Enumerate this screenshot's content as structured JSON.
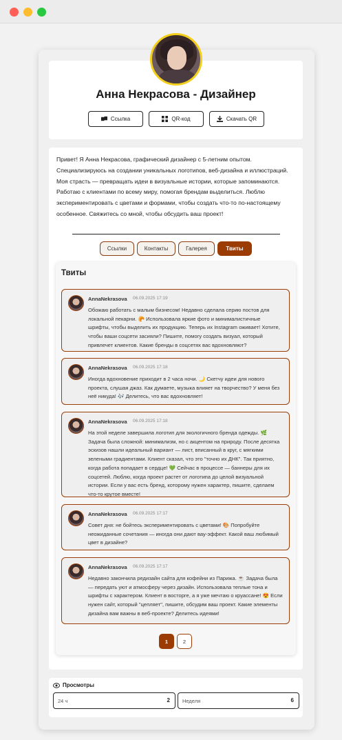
{
  "profile": {
    "name": "Анна Некрасова - Дизайнер",
    "buttons": {
      "link": "Ссылка",
      "qr": "QR-код",
      "download": "Скачать QR"
    },
    "bio": "Привет! Я Анна Некрасова, графический дизайнер с 5-летним опытом. Специализируюсь на создании уникальных логотипов, веб-дизайна и иллюстраций. Моя страсть — превращать идеи в визуальные истории, которые запоминаются. Работаю с клиентами по всему миру, помогая брендам выделиться. Люблю экспериментировать с цветами и формами, чтобы создать что-то по-настоящему особенное. Свяжитесь со мной, чтобы обсудить ваш проект!"
  },
  "tabs": [
    {
      "label": "Ссылки"
    },
    {
      "label": "Контакты"
    },
    {
      "label": "Галерея"
    },
    {
      "label": "Твиты"
    }
  ],
  "tweets_section": {
    "title": "Твиты",
    "items": [
      {
        "user": "AnnaNekrasova",
        "date": "06.09.2025 17:19",
        "text": "Обожаю работать с малым бизнесом! Недавно сделала серию постов для локальной пекарни. 🥐 Использовала яркие фото и минималистичные шрифты, чтобы выделить их продукцию. Теперь их Instagram оживает! Хотите, чтобы ваши соцсети засияли? Пишите, помогу создать визуал, который привлечет клиентов. Какие бренды в соцсетях вас вдохновляют?"
      },
      {
        "user": "AnnaNekrasova",
        "date": "06.09.2025 17:18",
        "text": "Иногда вдохновение приходит в 2 часа ночи. 🌙 Скетчу идеи для нового проекта, слушая джаз. Как думаете, музыка влияет на творчество? У меня без неё никуда! 🎶 Делитесь, что вас вдохновляет!"
      },
      {
        "user": "AnnaNekrasova",
        "date": "06.09.2025 17:18",
        "text": "На этой неделе завершила логотип для экологичного бренда одежды. 🌿 Задача была сложной: минимализм, но с акцентом на природу. После десятка эскизов нашли идеальный вариант — лист, вписанный в круг, с мягкими зелеными градиентами. Клиент сказал, что это \"точно их ДНК\". Так приятно, когда работа попадает в сердце! 💚 Сейчас в процессе — баннеры для их соцсетей. Люблю, когда проект растет от логотипа до целой визуальной истории. Если у вас есть бренд, которому нужен характер, пишите, сделаем что-то крутое вместе!"
      },
      {
        "user": "AnnaNekrasova",
        "date": "06.09.2025 17:17",
        "text": "Совет дня: не бойтесь экспериментировать с цветами! 🎨 Попробуйте неожиданные сочетания — иногда они дают вау-эффект. Какой ваш любимый цвет в дизайне?"
      },
      {
        "user": "AnnaNekrasova",
        "date": "06.09.2025 17:17",
        "text": "Недавно закончила редизайн сайта для кофейни из Парижа. ☕ Задача была — передать уют и атмосферу через дизайн. Использовала теплые тона и шрифты с характером. Клиент в восторге, а я уже мечтаю о круассане! 😍 Если нужен сайт, который \"цепляет\", пишите, обсудим ваш проект. Какие элементы дизайна вам важны в веб-проекте? Делитесь идеями!"
      }
    ]
  },
  "pagination": {
    "pages": [
      "1",
      "2"
    ],
    "current": "1"
  },
  "views": {
    "title": "Просмотры",
    "day_label": "24 ч",
    "day_value": "2",
    "week_label": "Неделя",
    "week_value": "6"
  },
  "colors": {
    "accent": "#9a3c04",
    "avatar_ring": "#f3cf1b"
  }
}
